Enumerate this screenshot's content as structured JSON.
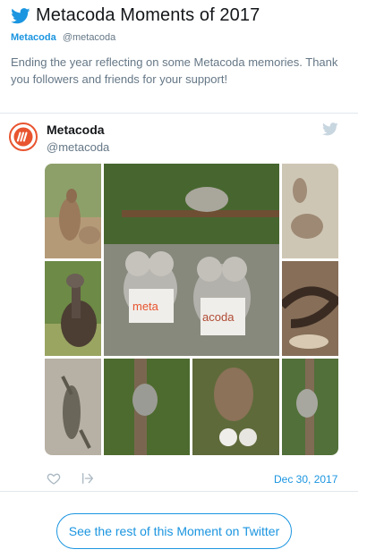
{
  "moment": {
    "title": "Metacoda Moments of 2017",
    "author_name": "Metacoda",
    "author_handle": "@metacoda",
    "description": "Ending the year reflecting on some Metacoda memories. Thank you followers and friends for your support!"
  },
  "tweet": {
    "author_name": "Metacoda",
    "author_handle": "@metacoda",
    "date": "Dec 30, 2017",
    "photo_text": "meta",
    "photo_text2": "acoda"
  },
  "cta": {
    "label": "See the rest of this Moment on Twitter"
  },
  "colors": {
    "twitter_blue": "#1b95e0",
    "brand_orange": "#e8542f",
    "text_gray": "#657786"
  },
  "icons": [
    "twitter-bird-icon",
    "heart-icon",
    "share-icon",
    "metacoda-logo"
  ]
}
